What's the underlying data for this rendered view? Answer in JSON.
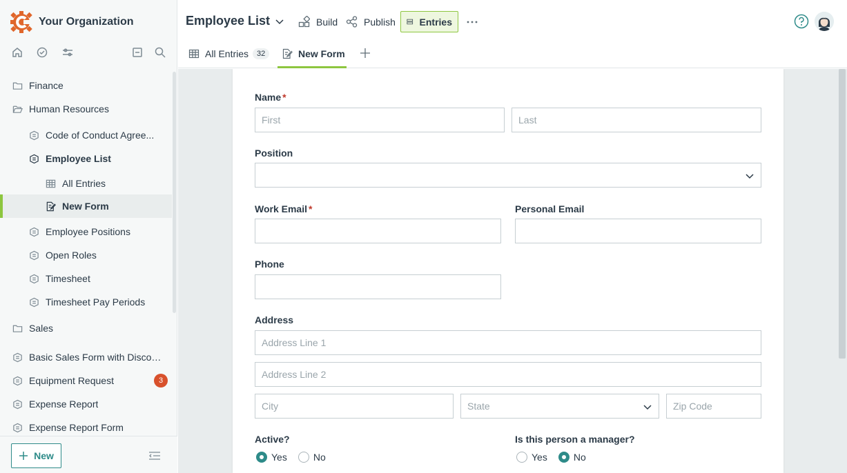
{
  "org": {
    "name": "Your Organization",
    "brand_color": "#e0662b"
  },
  "sidebar": {
    "tools": [
      "home-icon",
      "check-circle-icon",
      "filter-icon",
      "collapse-all-icon",
      "search-icon"
    ],
    "items": [
      {
        "label": "Finance",
        "icon": "folder-icon"
      },
      {
        "label": "Human Resources",
        "icon": "folder-open-icon"
      },
      {
        "label": "Code of Conduct Agree...",
        "icon": "app-icon"
      },
      {
        "label": "Employee List",
        "icon": "app-icon"
      },
      {
        "label": "All Entries",
        "icon": "table-icon"
      },
      {
        "label": "New Form",
        "icon": "form-icon"
      },
      {
        "label": "Employee Positions",
        "icon": "app-icon"
      },
      {
        "label": "Open Roles",
        "icon": "app-icon"
      },
      {
        "label": "Timesheet",
        "icon": "app-icon"
      },
      {
        "label": "Timesheet Pay Periods",
        "icon": "app-icon"
      },
      {
        "label": "Sales",
        "icon": "folder-icon"
      },
      {
        "label": "Basic Sales Form with Discou...",
        "icon": "app-icon"
      },
      {
        "label": "Equipment Request",
        "icon": "app-icon",
        "badge": "3"
      },
      {
        "label": "Expense Report",
        "icon": "app-icon"
      },
      {
        "label": "Expense Report Form",
        "icon": "app-icon"
      }
    ],
    "new_label": "New"
  },
  "header": {
    "title": "Employee List",
    "build_label": "Build",
    "publish_label": "Publish",
    "entries_label": "Entries",
    "tabs": [
      {
        "label": "All Entries",
        "count": "32"
      },
      {
        "label": "New Form"
      }
    ]
  },
  "form": {
    "name_label": "Name",
    "first_placeholder": "First",
    "last_placeholder": "Last",
    "position_label": "Position",
    "work_email_label": "Work Email",
    "personal_email_label": "Personal Email",
    "phone_label": "Phone",
    "address_label": "Address",
    "address1_placeholder": "Address Line 1",
    "address2_placeholder": "Address Line 2",
    "city_placeholder": "City",
    "state_placeholder": "State",
    "zip_placeholder": "Zip Code",
    "active_label": "Active?",
    "manager_label": "Is this person a manager?",
    "yes": "Yes",
    "no": "No",
    "required_mark": "*"
  },
  "colors": {
    "accent": "#8dc63f",
    "teal": "#2e8b89",
    "badge": "#d8512c"
  }
}
